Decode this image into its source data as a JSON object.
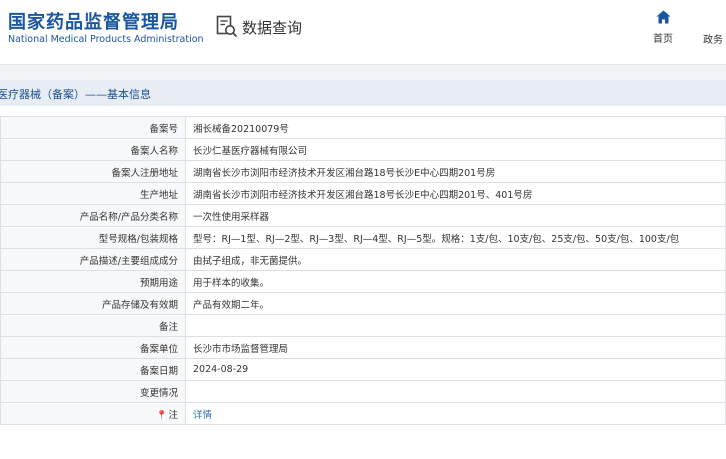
{
  "header": {
    "org_name_cn": "国家药品监督管理局",
    "org_name_en": "National Medical Products Administration",
    "query_label": "数据查询",
    "nav": {
      "home_label": "首页",
      "next_label": "政务"
    }
  },
  "section": {
    "title": "医疗器械（备案）——基本信息"
  },
  "rows": [
    {
      "label": "备案号",
      "value": "湘长械备20210079号"
    },
    {
      "label": "备案人名称",
      "value": "长沙仁基医疗器械有限公司"
    },
    {
      "label": "备案人注册地址",
      "value": "湖南省长沙市浏阳市经济技术开发区湘台路18号长沙E中心四期201号房"
    },
    {
      "label": "生产地址",
      "value": "湖南省长沙市浏阳市经济技术开发区湘台路18号长沙E中心四期201号、401号房"
    },
    {
      "label": "产品名称/产品分类名称",
      "value": "一次性使用采样器"
    },
    {
      "label": "型号规格/包装规格",
      "value": "型号：RJ—1型、RJ—2型、RJ—3型、RJ—4型、RJ—5型。规格：1支/包、10支/包、25支/包、50支/包、100支/包"
    },
    {
      "label": "产品描述/主要组成成分",
      "value": "由拭子组成，非无菌提供。"
    },
    {
      "label": "预期用途",
      "value": "用于样本的收集。"
    },
    {
      "label": "产品存储及有效期",
      "value": "产品有效期二年。"
    },
    {
      "label": "备注",
      "value": ""
    },
    {
      "label": "备案单位",
      "value": "长沙市市场监督管理局"
    },
    {
      "label": "备案日期",
      "value": "2024-08-29"
    },
    {
      "label": "变更情况",
      "value": ""
    },
    {
      "label": "注",
      "value": "详情",
      "pin": "📍"
    }
  ],
  "colors": {
    "brand_blue": "#1b56a0",
    "link_blue": "#2f6fb5",
    "label_bg": "#f7f8fa",
    "section_bg": "#e8edf3"
  },
  "icons": {
    "query": "magnifier-document-icon",
    "home": "home-icon",
    "note": "location-pin-icon"
  }
}
